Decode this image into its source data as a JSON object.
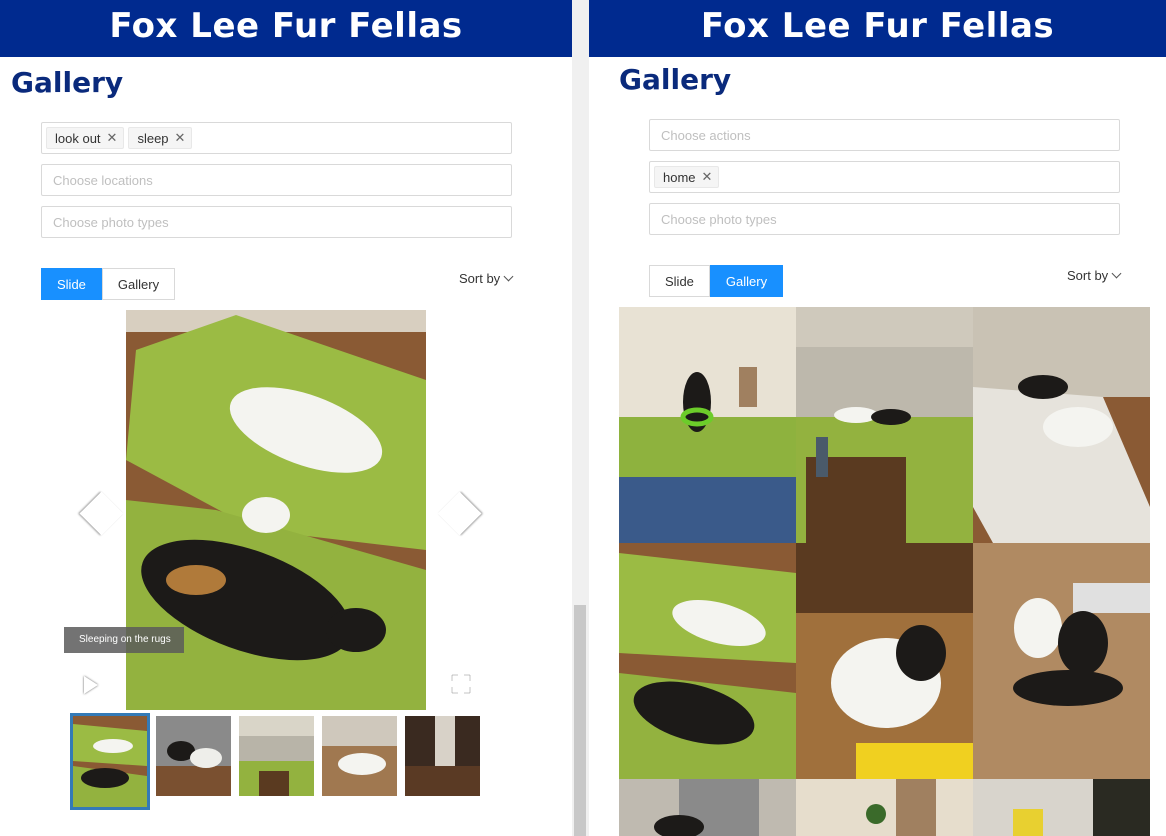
{
  "app_title": "Fox Lee Fur Fellas",
  "left": {
    "heading": "Gallery",
    "actions_tags": [
      "look out",
      "sleep"
    ],
    "locations_placeholder": "Choose locations",
    "photo_types_placeholder": "Choose photo types",
    "view_options": [
      "Slide",
      "Gallery"
    ],
    "active_view": "Slide",
    "sort_label": "Sort by",
    "caption": "Sleeping on the rugs",
    "thumbnail_count": 5
  },
  "right": {
    "heading": "Gallery",
    "actions_placeholder": "Choose actions",
    "location_tags": [
      "home"
    ],
    "photo_types_placeholder": "Choose photo types",
    "view_options": [
      "Slide",
      "Gallery"
    ],
    "active_view": "Gallery",
    "sort_label": "Sort by",
    "grid_rows_visible": 3
  },
  "colors": {
    "header": "#002a8f",
    "heading": "#0a2a7c",
    "accent": "#1890ff"
  },
  "icons": {
    "remove": "close-icon",
    "prev": "chevron-left-icon",
    "next": "chevron-right-icon",
    "play": "play-icon",
    "fullscreen": "fullscreen-icon",
    "sort": "chevron-down-icon"
  }
}
